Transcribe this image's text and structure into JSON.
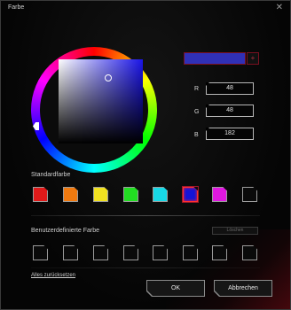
{
  "dialog": {
    "title": "Farbe",
    "close_glyph": "✕"
  },
  "picker": {
    "preview_color": "#3030b6",
    "add_label": "+"
  },
  "rgb": [
    {
      "label": "R",
      "value": "48"
    },
    {
      "label": "G",
      "value": "48"
    },
    {
      "label": "B",
      "value": "182"
    }
  ],
  "standard": {
    "title": "Standardfarbe",
    "swatches": [
      {
        "name": "red",
        "color": "#e01a1a"
      },
      {
        "name": "orange",
        "color": "#f07a10"
      },
      {
        "name": "yellow",
        "color": "#f0e020"
      },
      {
        "name": "green",
        "color": "#22dd22"
      },
      {
        "name": "cyan",
        "color": "#18d8e6"
      },
      {
        "name": "blue",
        "color": "#1414d8"
      },
      {
        "name": "magenta",
        "color": "#e018e0"
      },
      {
        "name": "black",
        "color": "#0a0a0a"
      }
    ]
  },
  "custom": {
    "title": "Benutzerdefinierte Farbe",
    "clear_label": "Löschen",
    "slot_count": 8
  },
  "footer": {
    "reset_label": "Alles zurücksetzen",
    "ok_label": "OK",
    "cancel_label": "Abbrechen"
  }
}
